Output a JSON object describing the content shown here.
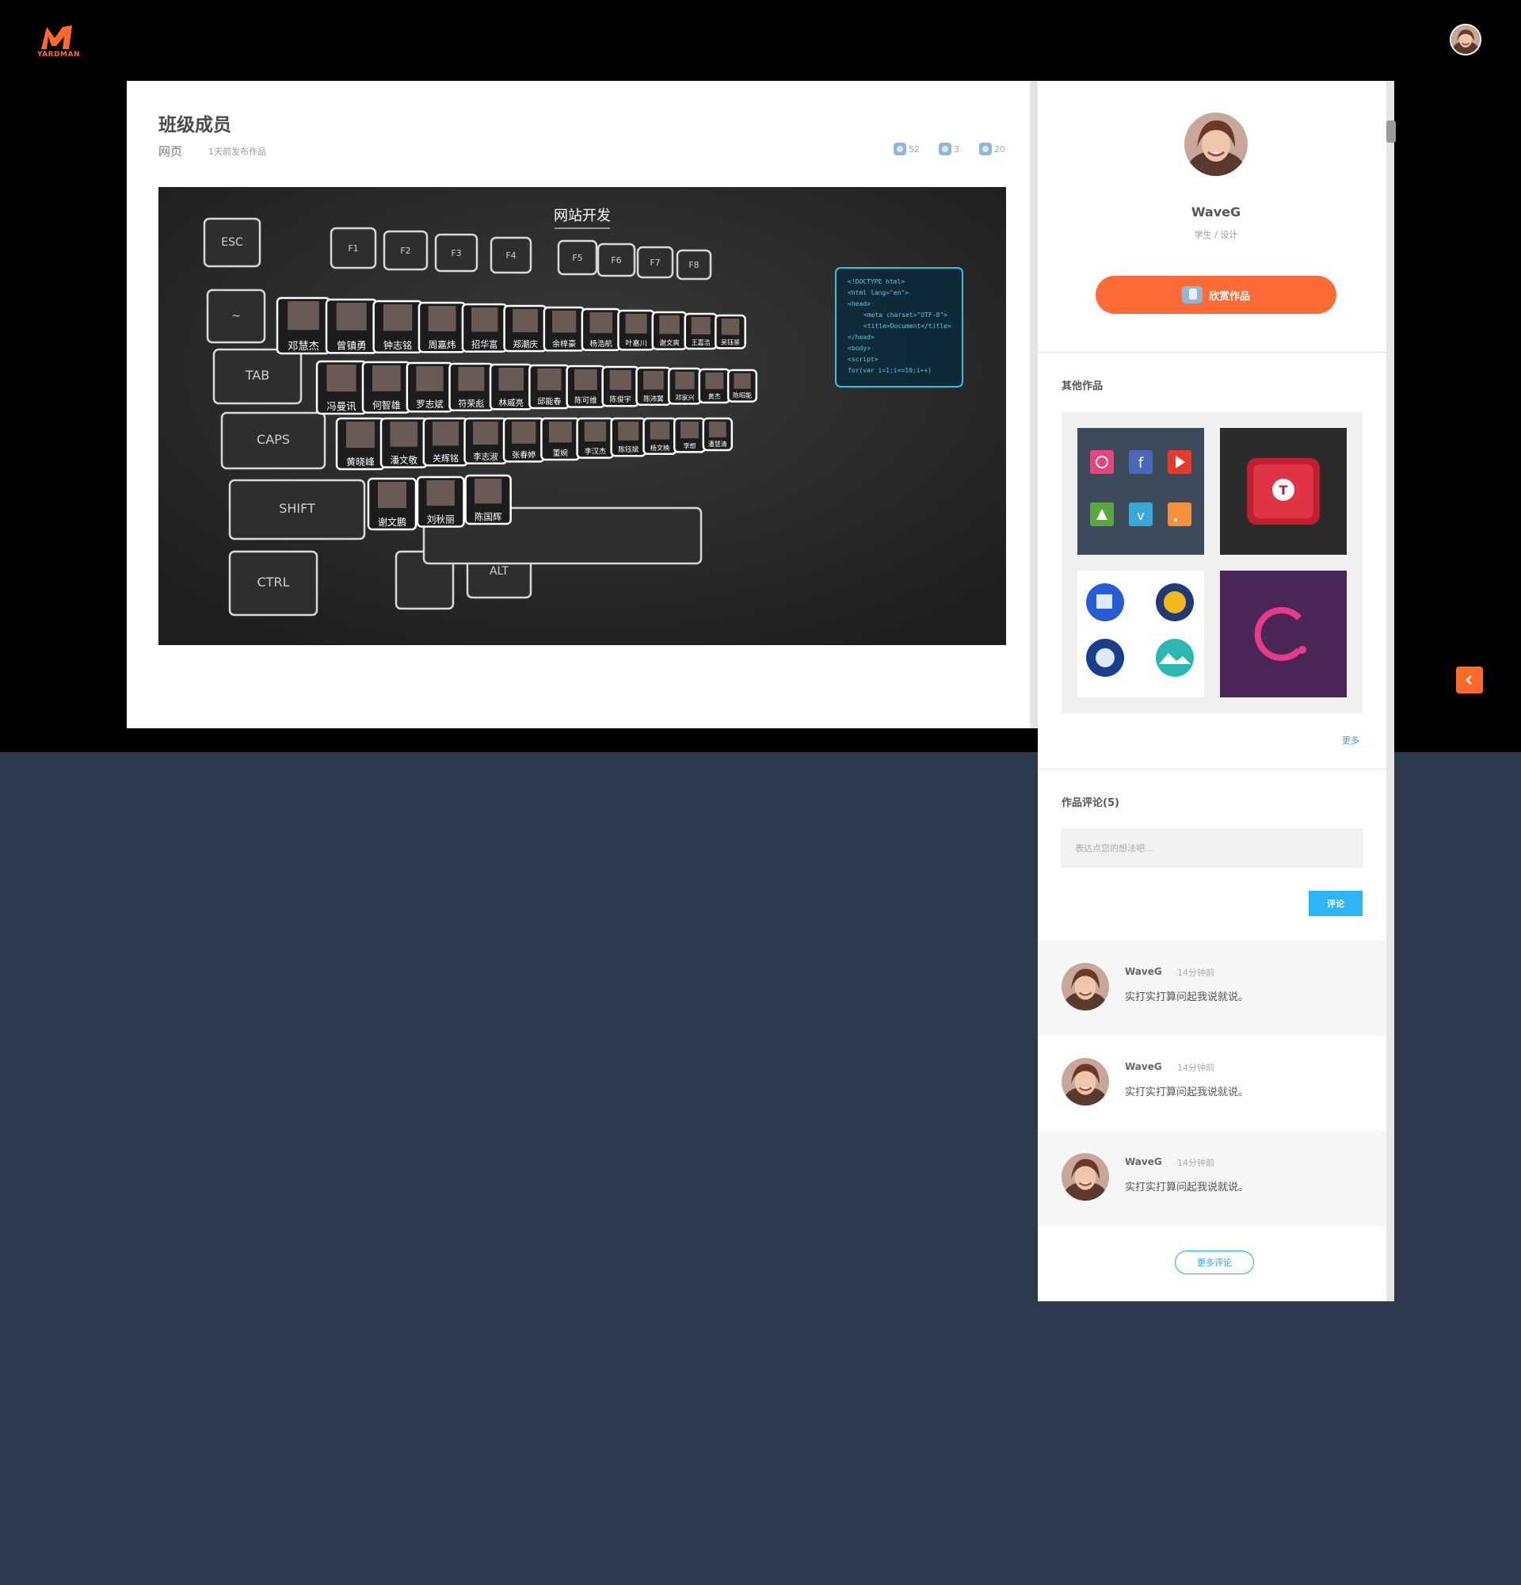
{
  "header": {
    "logo_text": "YARDMAN",
    "avatar_icon": "user-avatar"
  },
  "work": {
    "title": "班级成员",
    "category": "网页",
    "published": "1天前发布作品",
    "views": "52",
    "comments": "3",
    "likes": "20",
    "image_title": "网站开发",
    "keyboard_keys": [
      "ESC",
      "F1",
      "F2",
      "F3",
      "F4",
      "F5",
      "F6",
      "F7",
      "F8",
      "TAB",
      "CAPS",
      "SHIFT",
      "CTRL",
      "ALT",
      "~"
    ],
    "members_row1": [
      "邓慧杰",
      "曾镇勇",
      "钟志铭",
      "周嘉炜",
      "招华富",
      "郑潮庆",
      "余梓豪",
      "杨浩航",
      "叶嘉川",
      "谢文爽",
      "王嘉浩",
      "吴钰景"
    ],
    "members_row2": [
      "冯曼讯",
      "何智雄",
      "罗志斌",
      "符荣彪",
      "林威亮",
      "邱能春",
      "陈可维",
      "陈俊宇",
      "陈沛翼",
      "邓家兴",
      "黄杰",
      "陈昭能"
    ],
    "members_row3": [
      "黄晓峰",
      "潘文敬",
      "关辉铭",
      "李志淑",
      "张春婷",
      "董婉",
      "李汉杰",
      "陈钰斌",
      "杨文楠",
      "李想",
      "潘慧清"
    ],
    "members_row4": [
      "谢文鹏",
      "刘秋丽",
      "陈国辉"
    ],
    "code_lines": [
      "<!DOCTYPE html>",
      "<html lang=\"en\">",
      "<head>",
      "<meta charset=\"UTF-8\">",
      "<title>Document</title>",
      "</head>",
      "<body>",
      "<script>",
      "for(var i=1;i<=10;i++)"
    ]
  },
  "author": {
    "name": "WaveG",
    "role": "学生 / 设计",
    "appreciate_label": "欣赏作品"
  },
  "other_works": {
    "title": "其他作品",
    "more": "更多"
  },
  "comments_section": {
    "title": "作品评论(5)",
    "placeholder": "表达点您的想法吧...",
    "submit": "评论",
    "items": [
      {
        "name": "WaveG",
        "time": "14分钟前",
        "text": "实打实打算问起我说就说。"
      },
      {
        "name": "WaveG",
        "time": "14分钟前",
        "text": "实打实打算问起我说就说。"
      },
      {
        "name": "WaveG",
        "time": "14分钟前",
        "text": "实打实打算问起我说就说。"
      }
    ],
    "more_label": "更多评论"
  },
  "colors": {
    "accent_orange": "#ff6b35",
    "accent_blue": "#2cb4f5",
    "page_bg": "#2d3a4d"
  }
}
